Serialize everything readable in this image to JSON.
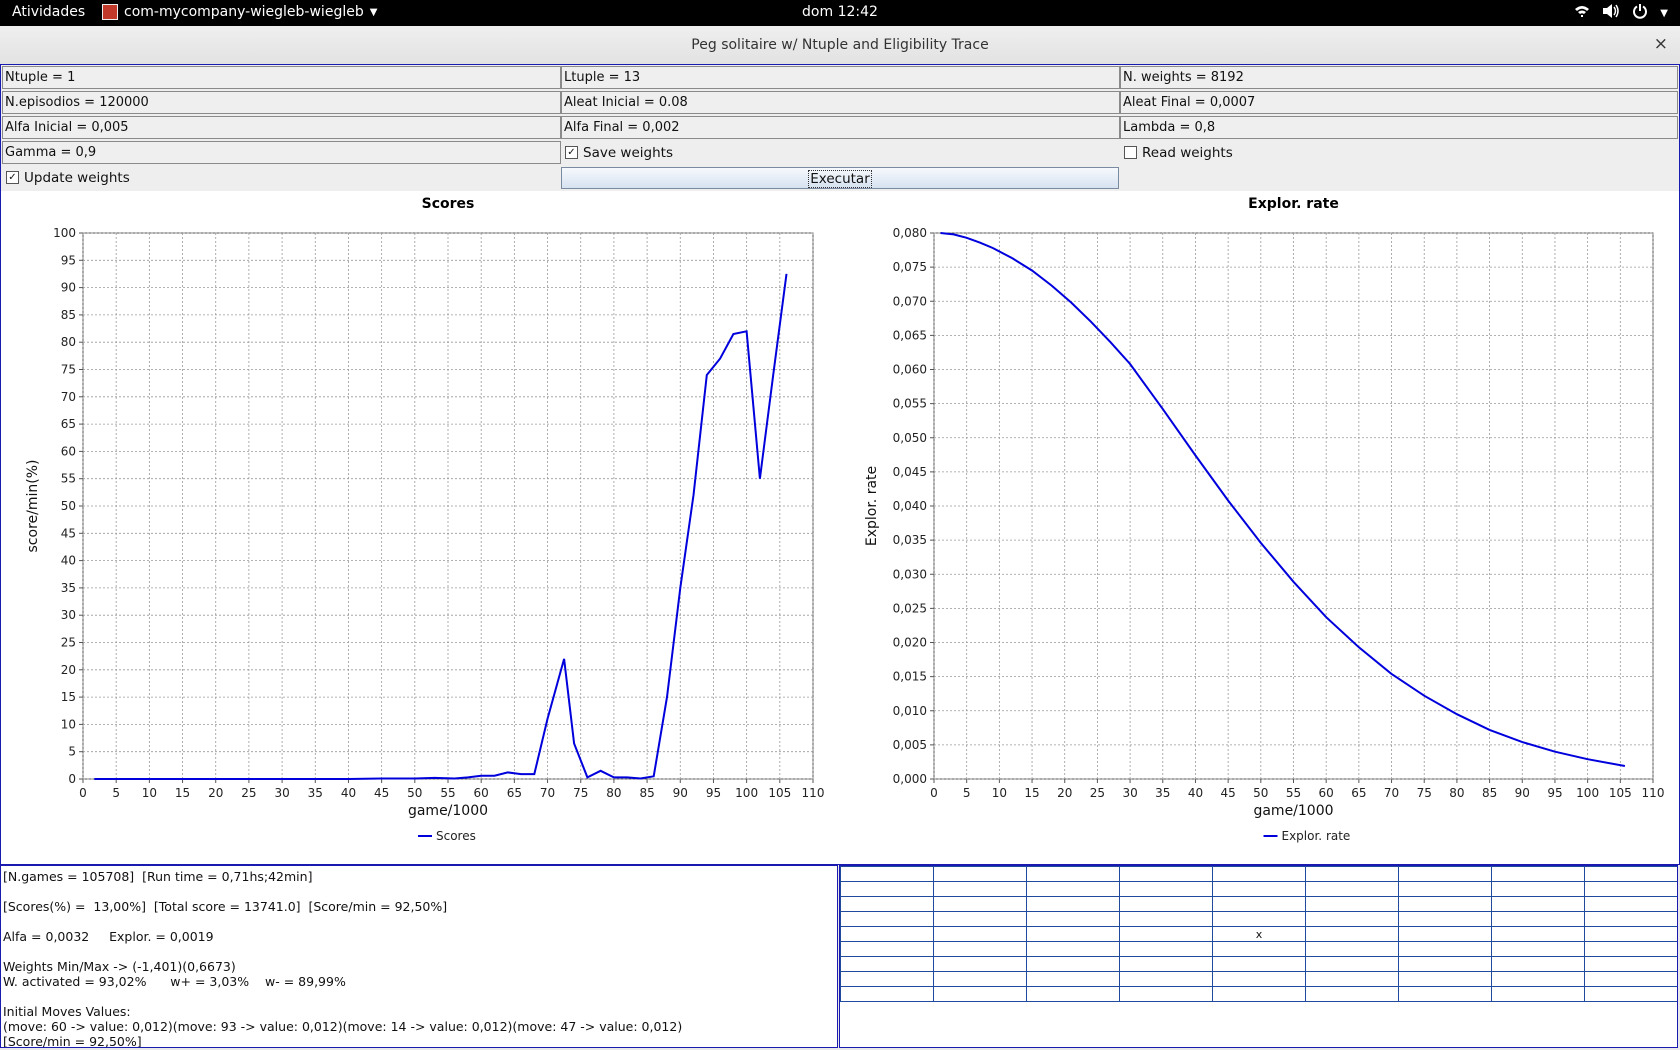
{
  "topbar": {
    "activities": "Atividades",
    "app_name": "com-mycompany-wiegleb-wiegleb",
    "clock": "dom 12:42"
  },
  "window": {
    "title": "Peg solitaire w/ Ntuple and Eligibility Trace",
    "close_glyph": "×"
  },
  "params": {
    "ntuple": "Ntuple = 1",
    "ltuple": "Ltuple = 13",
    "nweights": "N. weights = 8192",
    "nepisodios": "N.episodios = 120000",
    "aleat_inicial": "Aleat Inicial = 0.08",
    "aleat_final": "Aleat Final = 0,0007",
    "alfa_inicial": "Alfa Inicial = 0,005",
    "alfa_final": "Alfa Final = 0,002",
    "lambda": "Lambda = 0,8",
    "gamma": "Gamma = 0,9",
    "save_weights": {
      "label": "Save weights",
      "checked": true
    },
    "read_weights": {
      "label": "Read weights",
      "checked": false
    },
    "update_weights": {
      "label": "Update weights",
      "checked": true
    },
    "execute_label": "Executar"
  },
  "chart_data": [
    {
      "type": "line",
      "title": "Scores",
      "xlabel": "game/1000",
      "ylabel": "score/min(%)",
      "xlim": [
        0,
        110
      ],
      "ylim": [
        0,
        100
      ],
      "xticks": [
        0,
        5,
        10,
        15,
        20,
        25,
        30,
        35,
        40,
        45,
        50,
        55,
        60,
        65,
        70,
        75,
        80,
        85,
        90,
        95,
        100,
        105,
        110
      ],
      "yticks": [
        0,
        5,
        10,
        15,
        20,
        25,
        30,
        35,
        40,
        45,
        50,
        55,
        60,
        65,
        70,
        75,
        80,
        85,
        90,
        95,
        100
      ],
      "tick_decimals": 0,
      "grid": true,
      "legend": "bottom",
      "color": "#0000dd",
      "series": [
        {
          "name": "Scores",
          "x": [
            1.7,
            10,
            20,
            30,
            40,
            45,
            50,
            53,
            56,
            58,
            60,
            62,
            64,
            66,
            68,
            70,
            72.5,
            74,
            76,
            78,
            80,
            82,
            84,
            86,
            88,
            90,
            92,
            94,
            96,
            98,
            100,
            102,
            104,
            106
          ],
          "y": [
            0,
            0,
            0,
            0,
            0,
            0.1,
            0.1,
            0.2,
            0.1,
            0.3,
            0.6,
            0.6,
            1.2,
            0.9,
            0.9,
            11,
            22,
            6.5,
            0.3,
            1.5,
            0.3,
            0.3,
            0.1,
            0.5,
            15,
            35,
            52,
            74,
            77,
            81.5,
            82,
            55,
            74,
            92.5
          ]
        }
      ]
    },
    {
      "type": "line",
      "title": "Explor. rate",
      "xlabel": "game/1000",
      "ylabel": "Explor. rate",
      "xlim": [
        0,
        110
      ],
      "ylim": [
        0,
        0.08
      ],
      "xticks": [
        0,
        5,
        10,
        15,
        20,
        25,
        30,
        35,
        40,
        45,
        50,
        55,
        60,
        65,
        70,
        75,
        80,
        85,
        90,
        95,
        100,
        105,
        110
      ],
      "yticks": [
        0,
        0.005,
        0.01,
        0.015,
        0.02,
        0.025,
        0.03,
        0.035,
        0.04,
        0.045,
        0.05,
        0.055,
        0.06,
        0.065,
        0.07,
        0.075,
        0.08
      ],
      "tick_decimals": 3,
      "grid": true,
      "legend": "bottom",
      "color": "#0000dd",
      "series": [
        {
          "name": "Explor. rate",
          "x": [
            1,
            3,
            5,
            7,
            9,
            12,
            15,
            18,
            21,
            24,
            27,
            30,
            35,
            40,
            45,
            50,
            55,
            60,
            65,
            70,
            75,
            80,
            85,
            90,
            95,
            100,
            105.7
          ],
          "y": [
            0.08,
            0.0798,
            0.0793,
            0.0786,
            0.0778,
            0.0763,
            0.0745,
            0.0723,
            0.0698,
            0.067,
            0.064,
            0.0608,
            0.0542,
            0.0474,
            0.0408,
            0.0346,
            0.0289,
            0.0237,
            0.0193,
            0.0154,
            0.0122,
            0.0095,
            0.0072,
            0.0054,
            0.004,
            0.0029,
            0.0019
          ]
        }
      ]
    }
  ],
  "info": {
    "lines": [
      "[N.games = 105708]  [Run time = 0,71hs;42min]",
      "",
      "[Scores(%) =  13,00%]  [Total score = 13741.0]  [Score/min = 92,50%]",
      "",
      "Alfa = 0,0032     Explor. = 0,0019",
      "",
      "Weights Min/Max -> (-1,401)(0,6673)",
      "W. activated = 93,02%      w+ = 3,03%    w- = 89,99%",
      "",
      "Initial Moves Values:",
      "(move: 60 -> value: 0,012)(move: 93 -> value: 0,012)(move: 14 -> value: 0,012)(move: 47 -> value: 0,012)",
      "[Score/min = 92,50%]"
    ]
  },
  "board": {
    "rows": 9,
    "cols": 9,
    "marks": [
      {
        "row": 4,
        "col": 4,
        "text": "x"
      }
    ]
  }
}
